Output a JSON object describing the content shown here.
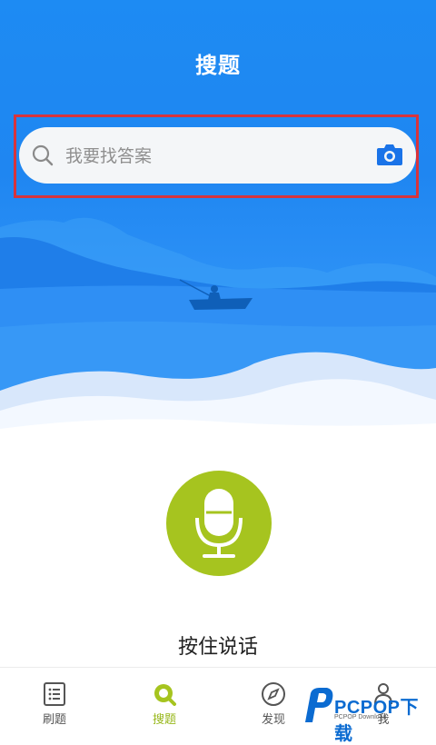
{
  "header": {
    "title": "搜题"
  },
  "search": {
    "placeholder": "我要找答案"
  },
  "voice": {
    "label": "按住说话"
  },
  "tabbar": {
    "items": [
      {
        "label": "刷题",
        "icon": "list-icon",
        "active": false
      },
      {
        "label": "搜题",
        "icon": "search-icon",
        "active": true
      },
      {
        "label": "发现",
        "icon": "compass-icon",
        "active": false
      },
      {
        "label": "我",
        "icon": "person-icon",
        "active": false
      }
    ]
  },
  "watermark": {
    "brand": "PCPOP下载",
    "sub": "PCPOP Download"
  },
  "colors": {
    "hero_blue": "#1d8bf3",
    "accent_green": "#a6c41f",
    "highlight_red": "#d7343c"
  }
}
